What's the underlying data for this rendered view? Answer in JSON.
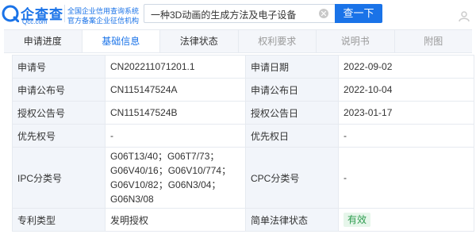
{
  "header": {
    "logo_title": "企查查",
    "logo_domain": "Qcc.com",
    "logo_line1": "全国企业信用查询系统",
    "logo_line2": "官方备案企业征信机构",
    "search_query": "一种3D动画的生成方法及电子设备",
    "search_button": "查一下"
  },
  "tabs": [
    {
      "label": "申请进度",
      "state": "normal"
    },
    {
      "label": "基础信息",
      "state": "active"
    },
    {
      "label": "法律状态",
      "state": "normal"
    },
    {
      "label": "权利要求",
      "state": "disabled"
    },
    {
      "label": "说明书",
      "state": "disabled"
    },
    {
      "label": "附图",
      "state": "disabled"
    }
  ],
  "rows": [
    {
      "label1": "申请号",
      "value1": "CN202211071201.1",
      "label2": "申请日期",
      "value2": "2022-09-02"
    },
    {
      "label1": "申请公布号",
      "value1": "CN115147524A",
      "label2": "申请公布日",
      "value2": "2022-10-04"
    },
    {
      "label1": "授权公告号",
      "value1": "CN115147524B",
      "label2": "授权公告日",
      "value2": "2023-01-17"
    },
    {
      "label1": "优先权号",
      "value1": "-",
      "label2": "优先权日",
      "value2": "-"
    },
    {
      "label1": "IPC分类号",
      "value1": "G06T13/40；G06T7/73；G06V40/16；G06V10/774；G06V10/82；G06N3/04；G06N3/08",
      "label2": "CPC分类号",
      "value2": "-"
    },
    {
      "label1": "专利类型",
      "value1": "发明授权",
      "label2": "简单法律状态",
      "value2": "有效"
    }
  ],
  "colors": {
    "accent": "#1a73e8",
    "valid_badge_bg": "#e6f6ea",
    "valid_badge_text": "#2e9c4f"
  },
  "icons": {
    "logo": "qcc-logo-icon",
    "clear": "clear-icon",
    "header_right": "user-icon"
  }
}
